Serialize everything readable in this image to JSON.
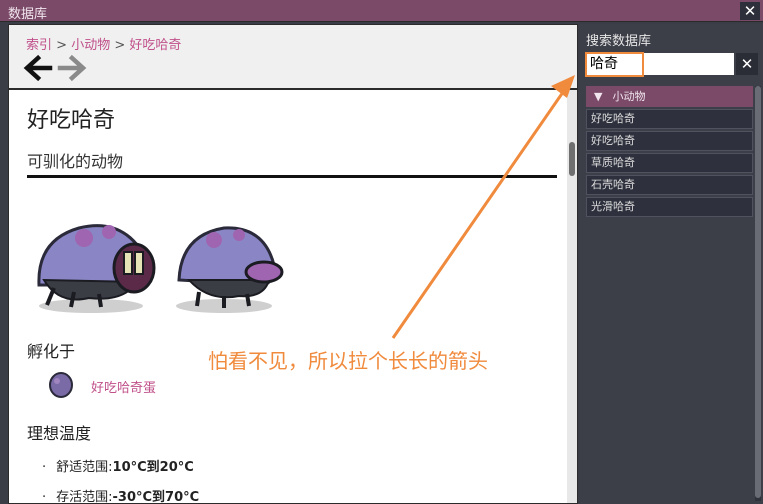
{
  "window": {
    "title": "数据库",
    "close_glyph": "✕"
  },
  "breadcrumb": {
    "first": "索引",
    "sep1": " > ",
    "second": "小动物",
    "sep2": " > ",
    "third": "好吃哈奇"
  },
  "nav": {
    "back_icon": "arrow-left-icon",
    "forward_icon": "arrow-right-icon"
  },
  "article": {
    "title": "好吃哈奇",
    "subtitle": "可驯化的动物",
    "hatch_heading": "孵化于",
    "egg_label": "好吃哈奇蛋",
    "temp_heading": "理想温度",
    "temps": [
      {
        "bullet": "·",
        "label": "舒适范围:",
        "value": "10°C到20°C"
      },
      {
        "bullet": "·",
        "label": "存活范围:",
        "value": "-30°C到70°C"
      }
    ]
  },
  "sidebar": {
    "search_label": "搜索数据库",
    "search_value": "哈奇",
    "clear_glyph": "✕",
    "category": {
      "glyph": "▼",
      "label": "小动物"
    },
    "items": [
      "好吃哈奇",
      "好吃哈奇",
      "草质哈奇",
      "石壳哈奇",
      "光滑哈奇"
    ]
  },
  "annotation": {
    "text": "怕看不见，所以拉个长长的箭头",
    "color": "#f08a3c"
  },
  "colors": {
    "titlebar": "#7a4a68",
    "link": "#c0508a",
    "accent": "#f08a3c",
    "sidebar": "#3c3e48"
  }
}
